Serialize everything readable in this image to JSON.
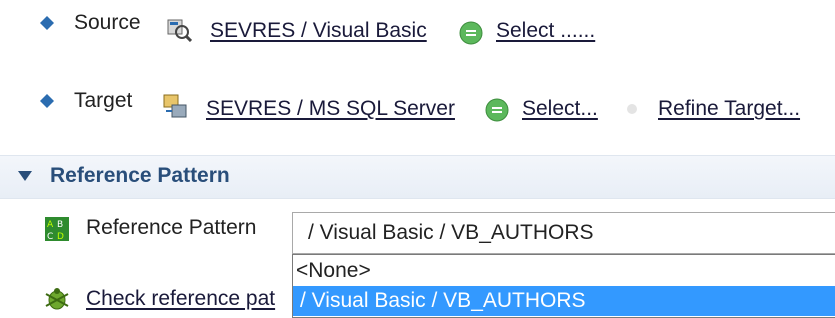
{
  "source": {
    "label": "Source",
    "value": "SEVRES / Visual Basic",
    "select_label": "Select ......"
  },
  "target": {
    "label": "Target",
    "value": "SEVRES / MS SQL Server",
    "select_label": "Select...",
    "refine_label": "Refine Target..."
  },
  "section": {
    "title": "Reference Pattern"
  },
  "reference_pattern": {
    "label": "Reference Pattern",
    "selected": "/ Visual Basic / VB_AUTHORS",
    "options": [
      "<None>",
      "/ Visual Basic / VB_AUTHORS"
    ],
    "highlighted_index": 1
  },
  "check_link": {
    "label": "Check reference pat"
  },
  "colors": {
    "bullet": "#2b6cb0",
    "section_text": "#294e7a",
    "highlight": "#3399ff",
    "select_green": "#5cb85c"
  }
}
